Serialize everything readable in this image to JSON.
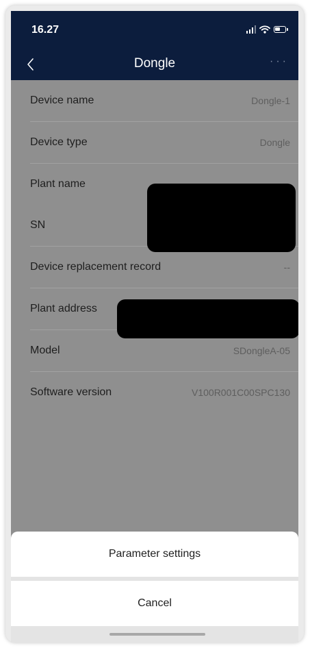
{
  "status_bar": {
    "time": "16.27",
    "signal_icon": "signal-icon",
    "wifi_icon": "wifi-icon",
    "battery_icon": "battery-icon"
  },
  "header": {
    "title": "Dongle",
    "back_icon": "chevron-left-icon",
    "more_label": "···",
    "background_color": "#0c1d3d"
  },
  "details": [
    {
      "label": "Device name",
      "value": "Dongle-1"
    },
    {
      "label": "Device type",
      "value": "Dongle"
    },
    {
      "label": "Plant name",
      "value": ""
    },
    {
      "label": "SN",
      "value": ""
    },
    {
      "label": "Device replacement record",
      "value": "--"
    },
    {
      "label": "Plant address",
      "value": ""
    },
    {
      "label": "Model",
      "value": "SDongleA-05"
    },
    {
      "label": "Software version",
      "value": "V100R001C00SPC130"
    }
  ],
  "action_sheet": {
    "parameter_settings": "Parameter settings",
    "cancel": "Cancel"
  }
}
